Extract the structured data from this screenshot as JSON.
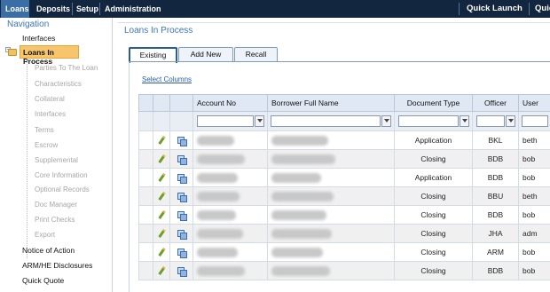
{
  "menubar": {
    "items": [
      "Loans",
      "Deposits",
      "Setup",
      "Administration"
    ],
    "active": "Loans",
    "quick_launch": "Quick Launch",
    "quick_cut": "Quic"
  },
  "nav": {
    "title": "Navigation",
    "items_top": [
      "Interfaces"
    ],
    "active_item": "Loans In Process",
    "sub_items": [
      "Parties To The Loan",
      "Characteristics",
      "Collateral",
      "Interfaces",
      "Terms",
      "Escrow",
      "Supplemental",
      "Core Information",
      "Optional Records",
      "Doc Manager",
      "Print Checks",
      "Export"
    ],
    "items_bottom": [
      "Notice of Action",
      "ARM/HE Disclosures",
      "Quick Quote"
    ]
  },
  "main": {
    "title": "Loans In Process",
    "tabs": [
      "Existing",
      "Add New",
      "Recall"
    ],
    "active_tab": "Existing",
    "select_columns": "Select Columns",
    "columns": [
      "Account No",
      "Borrower Full Name",
      "Document Type",
      "Officer",
      "User"
    ],
    "rows": [
      {
        "doc_type": "Application",
        "officer": "BKL",
        "user": "beth"
      },
      {
        "doc_type": "Closing",
        "officer": "BDB",
        "user": "bob"
      },
      {
        "doc_type": "Application",
        "officer": "BDB",
        "user": "bob"
      },
      {
        "doc_type": "Closing",
        "officer": "BBU",
        "user": "beth"
      },
      {
        "doc_type": "Closing",
        "officer": "BDB",
        "user": "bob"
      },
      {
        "doc_type": "Closing",
        "officer": "JHA",
        "user": "adm"
      },
      {
        "doc_type": "Closing",
        "officer": "ARM",
        "user": "bob"
      },
      {
        "doc_type": "Closing",
        "officer": "BDB",
        "user": "bob"
      }
    ]
  },
  "colors": {
    "menubar_bg": "#13263f",
    "active_menu": "#3b6ea5",
    "nav_active_bg": "#f7c56c",
    "title_blue": "#3a76b7",
    "header_bg": "#dfe8f3"
  }
}
